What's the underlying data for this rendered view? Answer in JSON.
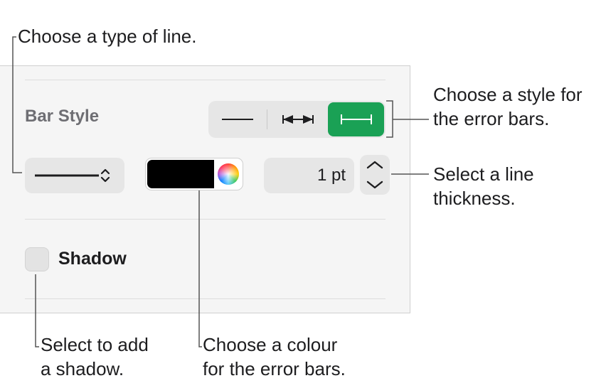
{
  "panel": {
    "bar_style_label": "Bar Style",
    "segmented_styles": [
      "plain-line",
      "arrow-caps",
      "bracket-caps"
    ],
    "selected_style": "bracket-caps",
    "line_type": "solid-line",
    "color": {
      "selected": "#000000"
    },
    "thickness": {
      "value": "1 pt"
    },
    "shadow": {
      "label": "Shadow",
      "checked": false
    },
    "accent_color": "#1aa155"
  },
  "callouts": {
    "line_type": "Choose a type of line.",
    "style_line1": "Choose a style for",
    "style_line2": "the error bars.",
    "thickness_line1": "Select a line",
    "thickness_line2": "thickness.",
    "shadow_line1": "Select to add",
    "shadow_line2": "a shadow.",
    "colour_line1": "Choose a colour",
    "colour_line2": "for the error bars."
  }
}
